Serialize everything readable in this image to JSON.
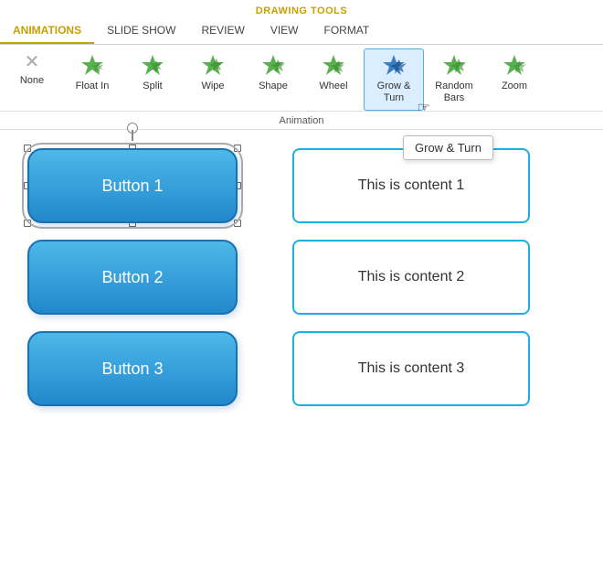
{
  "drawing_tools": {
    "label": "DRAWING TOOLS"
  },
  "tabs": [
    {
      "id": "animations",
      "label": "ANIMATIONS",
      "active": true
    },
    {
      "id": "slideshow",
      "label": "SLIDE SHOW",
      "active": false
    },
    {
      "id": "review",
      "label": "REVIEW",
      "active": false
    },
    {
      "id": "view",
      "label": "VIEW",
      "active": false
    },
    {
      "id": "format",
      "label": "FORMAT",
      "active": false
    }
  ],
  "animations": [
    {
      "id": "none",
      "label": "None",
      "icon": "none"
    },
    {
      "id": "float-in",
      "label": "Float In",
      "icon": "star-green"
    },
    {
      "id": "split",
      "label": "Split",
      "icon": "star-green"
    },
    {
      "id": "wipe",
      "label": "Wipe",
      "icon": "star-green"
    },
    {
      "id": "shape",
      "label": "Shape",
      "icon": "star-green"
    },
    {
      "id": "wheel",
      "label": "Wheel",
      "icon": "star-green"
    },
    {
      "id": "grow-turn",
      "label": "Grow & Turn",
      "icon": "star-blue",
      "active": true
    },
    {
      "id": "random-bars",
      "label": "Random Bars",
      "icon": "star-green"
    },
    {
      "id": "zoom",
      "label": "Zoom",
      "icon": "star-green"
    }
  ],
  "ribbon_section": "Animation",
  "tooltip": "Grow & Turn",
  "buttons": [
    {
      "label": "Button 1",
      "selected": true
    },
    {
      "label": "Button 2",
      "selected": false
    },
    {
      "label": "Button 3",
      "selected": false
    }
  ],
  "content_boxes": [
    {
      "label": "This is content 1"
    },
    {
      "label": "This is content 2"
    },
    {
      "label": "This is content 3"
    }
  ]
}
